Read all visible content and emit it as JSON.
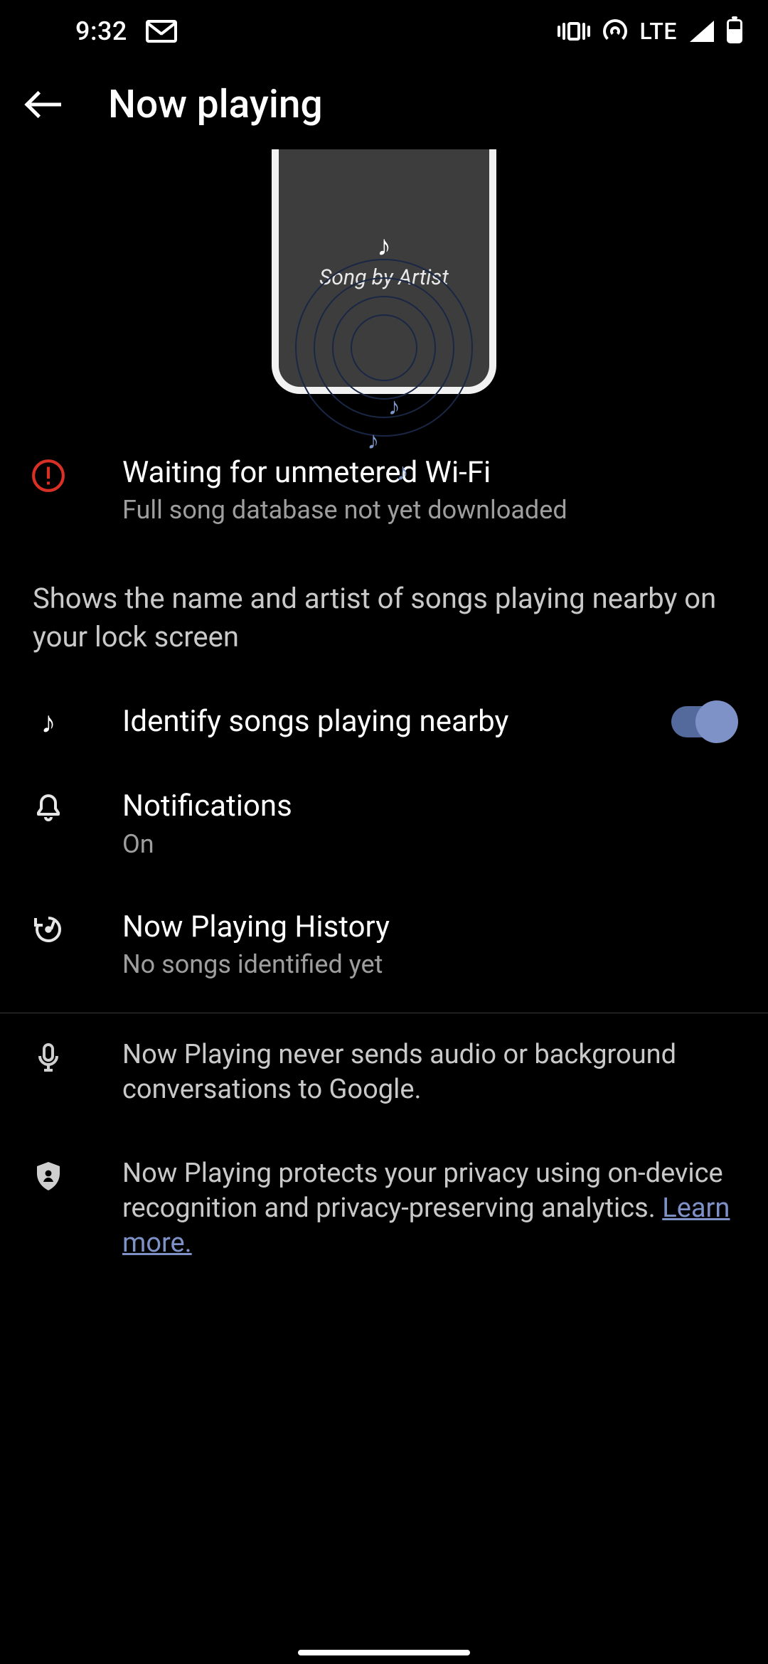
{
  "status": {
    "time": "9:32",
    "network_label": "LTE"
  },
  "header": {
    "title": "Now playing"
  },
  "hero": {
    "song_label": "Song by Artist"
  },
  "alert": {
    "title": "Waiting for unmetered Wi-Fi",
    "subtitle": "Full song database not yet downloaded"
  },
  "description": "Shows the name and artist of songs playing nearby on your lock screen",
  "rows": {
    "identify": {
      "title": "Identify songs playing nearby",
      "enabled": true
    },
    "notifications": {
      "title": "Notifications",
      "subtitle": "On"
    },
    "history": {
      "title": "Now Playing History",
      "subtitle": "No songs identified yet"
    }
  },
  "info": {
    "audio": "Now Playing never sends audio or background conversations to Google.",
    "privacy_prefix": "Now Playing protects your privacy using on-device recognition and privacy-preserving analytics. ",
    "learn_more_label": "Learn more."
  }
}
